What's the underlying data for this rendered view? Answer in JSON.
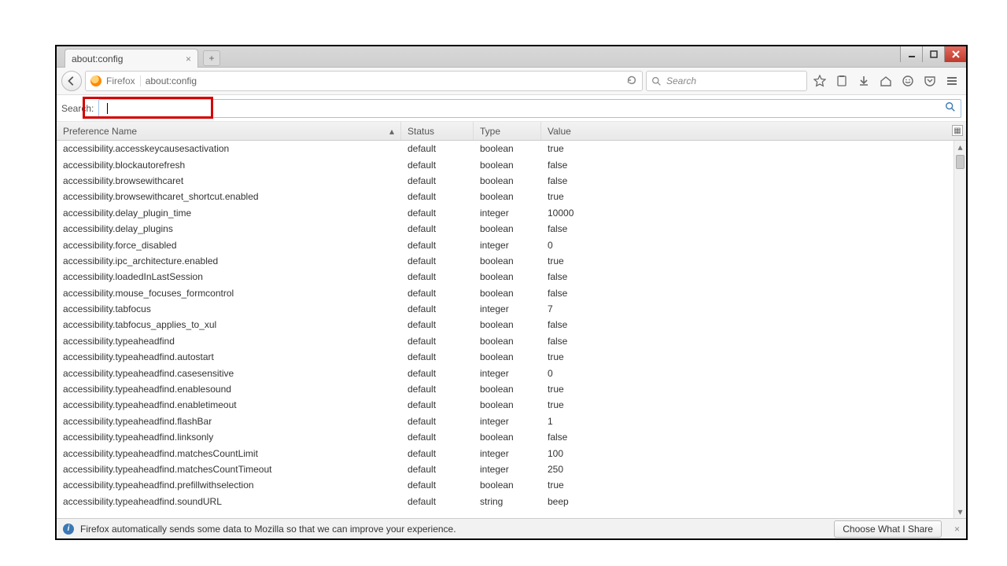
{
  "window": {
    "tab_title": "about:config",
    "new_tab_tooltip": "+"
  },
  "nav": {
    "identity_label": "Firefox",
    "url": "about:config",
    "search_placeholder": "Search"
  },
  "prefsearch": {
    "label": "Search:",
    "value": ""
  },
  "columns": {
    "name": "Preference Name",
    "status": "Status",
    "type": "Type",
    "value": "Value"
  },
  "rows": [
    {
      "name": "accessibility.accesskeycausesactivation",
      "status": "default",
      "type": "boolean",
      "value": "true"
    },
    {
      "name": "accessibility.blockautorefresh",
      "status": "default",
      "type": "boolean",
      "value": "false"
    },
    {
      "name": "accessibility.browsewithcaret",
      "status": "default",
      "type": "boolean",
      "value": "false"
    },
    {
      "name": "accessibility.browsewithcaret_shortcut.enabled",
      "status": "default",
      "type": "boolean",
      "value": "true"
    },
    {
      "name": "accessibility.delay_plugin_time",
      "status": "default",
      "type": "integer",
      "value": "10000"
    },
    {
      "name": "accessibility.delay_plugins",
      "status": "default",
      "type": "boolean",
      "value": "false"
    },
    {
      "name": "accessibility.force_disabled",
      "status": "default",
      "type": "integer",
      "value": "0"
    },
    {
      "name": "accessibility.ipc_architecture.enabled",
      "status": "default",
      "type": "boolean",
      "value": "true"
    },
    {
      "name": "accessibility.loadedInLastSession",
      "status": "default",
      "type": "boolean",
      "value": "false"
    },
    {
      "name": "accessibility.mouse_focuses_formcontrol",
      "status": "default",
      "type": "boolean",
      "value": "false"
    },
    {
      "name": "accessibility.tabfocus",
      "status": "default",
      "type": "integer",
      "value": "7"
    },
    {
      "name": "accessibility.tabfocus_applies_to_xul",
      "status": "default",
      "type": "boolean",
      "value": "false"
    },
    {
      "name": "accessibility.typeaheadfind",
      "status": "default",
      "type": "boolean",
      "value": "false"
    },
    {
      "name": "accessibility.typeaheadfind.autostart",
      "status": "default",
      "type": "boolean",
      "value": "true"
    },
    {
      "name": "accessibility.typeaheadfind.casesensitive",
      "status": "default",
      "type": "integer",
      "value": "0"
    },
    {
      "name": "accessibility.typeaheadfind.enablesound",
      "status": "default",
      "type": "boolean",
      "value": "true"
    },
    {
      "name": "accessibility.typeaheadfind.enabletimeout",
      "status": "default",
      "type": "boolean",
      "value": "true"
    },
    {
      "name": "accessibility.typeaheadfind.flashBar",
      "status": "default",
      "type": "integer",
      "value": "1"
    },
    {
      "name": "accessibility.typeaheadfind.linksonly",
      "status": "default",
      "type": "boolean",
      "value": "false"
    },
    {
      "name": "accessibility.typeaheadfind.matchesCountLimit",
      "status": "default",
      "type": "integer",
      "value": "100"
    },
    {
      "name": "accessibility.typeaheadfind.matchesCountTimeout",
      "status": "default",
      "type": "integer",
      "value": "250"
    },
    {
      "name": "accessibility.typeaheadfind.prefillwithselection",
      "status": "default",
      "type": "boolean",
      "value": "true"
    },
    {
      "name": "accessibility.typeaheadfind.soundURL",
      "status": "default",
      "type": "string",
      "value": "beep"
    }
  ],
  "infobar": {
    "message": "Firefox automatically sends some data to Mozilla so that we can improve your experience.",
    "button": "Choose What I Share"
  }
}
